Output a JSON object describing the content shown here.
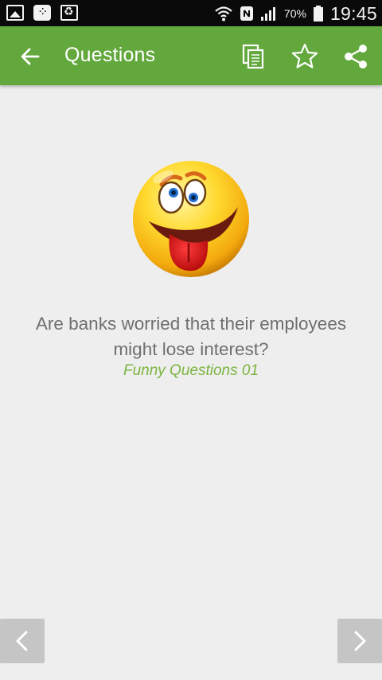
{
  "status_bar": {
    "left_icons": [
      "gallery-icon",
      "bbm-icon",
      "recycle-icon"
    ],
    "battery_percent": "70%",
    "time": "19:45"
  },
  "app_bar": {
    "title": "Questions",
    "color": "#62a83d",
    "actions": [
      "copy-icon",
      "star-icon",
      "share-icon"
    ]
  },
  "question": {
    "text": "Are banks worried that their employees might lose interest?",
    "category": "Funny Questions 01",
    "category_color": "#7ab53f"
  },
  "navigation": {
    "previous": "chevron-left-icon",
    "next": "chevron-right-icon"
  }
}
